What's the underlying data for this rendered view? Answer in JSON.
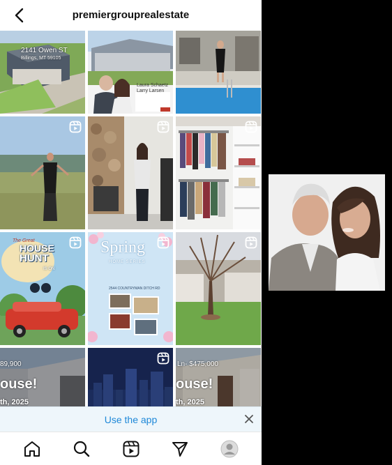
{
  "header": {
    "username": "premiergrouprealestate",
    "back_icon": "chevron-left-icon"
  },
  "posts": [
    {
      "id": "p1",
      "type": "post",
      "address_line1": "2141 Owen ST",
      "address_line2": "Billings, MT 59105"
    },
    {
      "id": "p2",
      "type": "post",
      "agents_line1": "Laura Schaetz",
      "agents_line2": "Larry Larsen"
    },
    {
      "id": "p3",
      "type": "post"
    },
    {
      "id": "p4",
      "type": "reel"
    },
    {
      "id": "p5",
      "type": "reel"
    },
    {
      "id": "p6",
      "type": "reel"
    },
    {
      "id": "p7",
      "type": "reel",
      "title_top": "The Great",
      "title_main1": "HOUSE",
      "title_main2": "HUNT",
      "title_sub": "IS ON"
    },
    {
      "id": "p8",
      "type": "reel",
      "title": "Spring",
      "subtitle": "HOME SERIES",
      "address": "2544 COUNTRYMAN DITCH RD"
    },
    {
      "id": "p9",
      "type": "reel"
    },
    {
      "id": "p10",
      "type": "post",
      "price": "89,900",
      "headline": "ouse!",
      "date": "th, 2025"
    },
    {
      "id": "p11",
      "type": "reel"
    },
    {
      "id": "p12",
      "type": "post",
      "price": "Ln- $475,000",
      "headline": "ouse!",
      "date": "th, 2025"
    }
  ],
  "banner": {
    "use_app_label": "Use the app",
    "close_icon": "close-icon"
  },
  "bottom_nav": {
    "items": [
      {
        "name": "home",
        "icon": "home-icon"
      },
      {
        "name": "explore",
        "icon": "search-icon"
      },
      {
        "name": "reels",
        "icon": "reels-icon"
      },
      {
        "name": "direct",
        "icon": "send-icon"
      },
      {
        "name": "profile",
        "icon": "avatar-icon"
      }
    ]
  },
  "colors": {
    "link_blue": "#1e88d8",
    "banner_bg": "#eef6fb",
    "page_bg": "#000000"
  }
}
